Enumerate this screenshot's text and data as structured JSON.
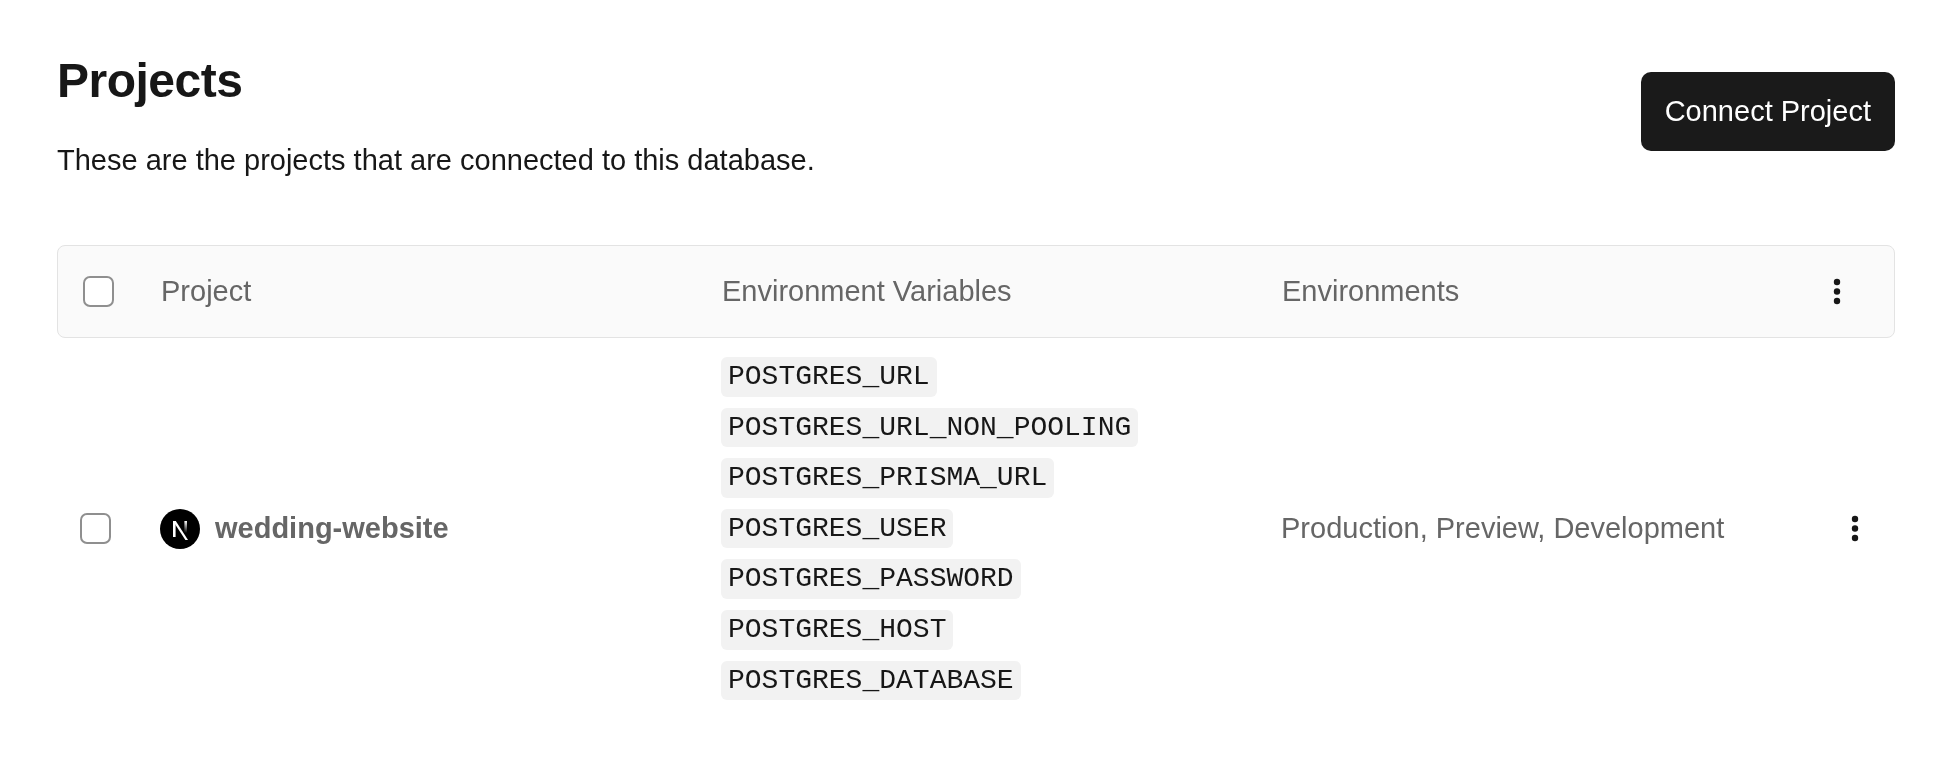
{
  "header": {
    "title": "Projects",
    "subtitle": "These are the projects that are connected to this database.",
    "connect_button": "Connect Project"
  },
  "table": {
    "select_all": {
      "checked": false
    },
    "columns": [
      "Project",
      "Environment Variables",
      "Environments"
    ],
    "rows": [
      {
        "checked": false,
        "project": "wedding-website",
        "env_vars": [
          "POSTGRES_URL",
          "POSTGRES_URL_NON_POOLING",
          "POSTGRES_PRISMA_URL",
          "POSTGRES_USER",
          "POSTGRES_PASSWORD",
          "POSTGRES_HOST",
          "POSTGRES_DATABASE"
        ],
        "environments": "Production, Preview, Development"
      }
    ]
  }
}
